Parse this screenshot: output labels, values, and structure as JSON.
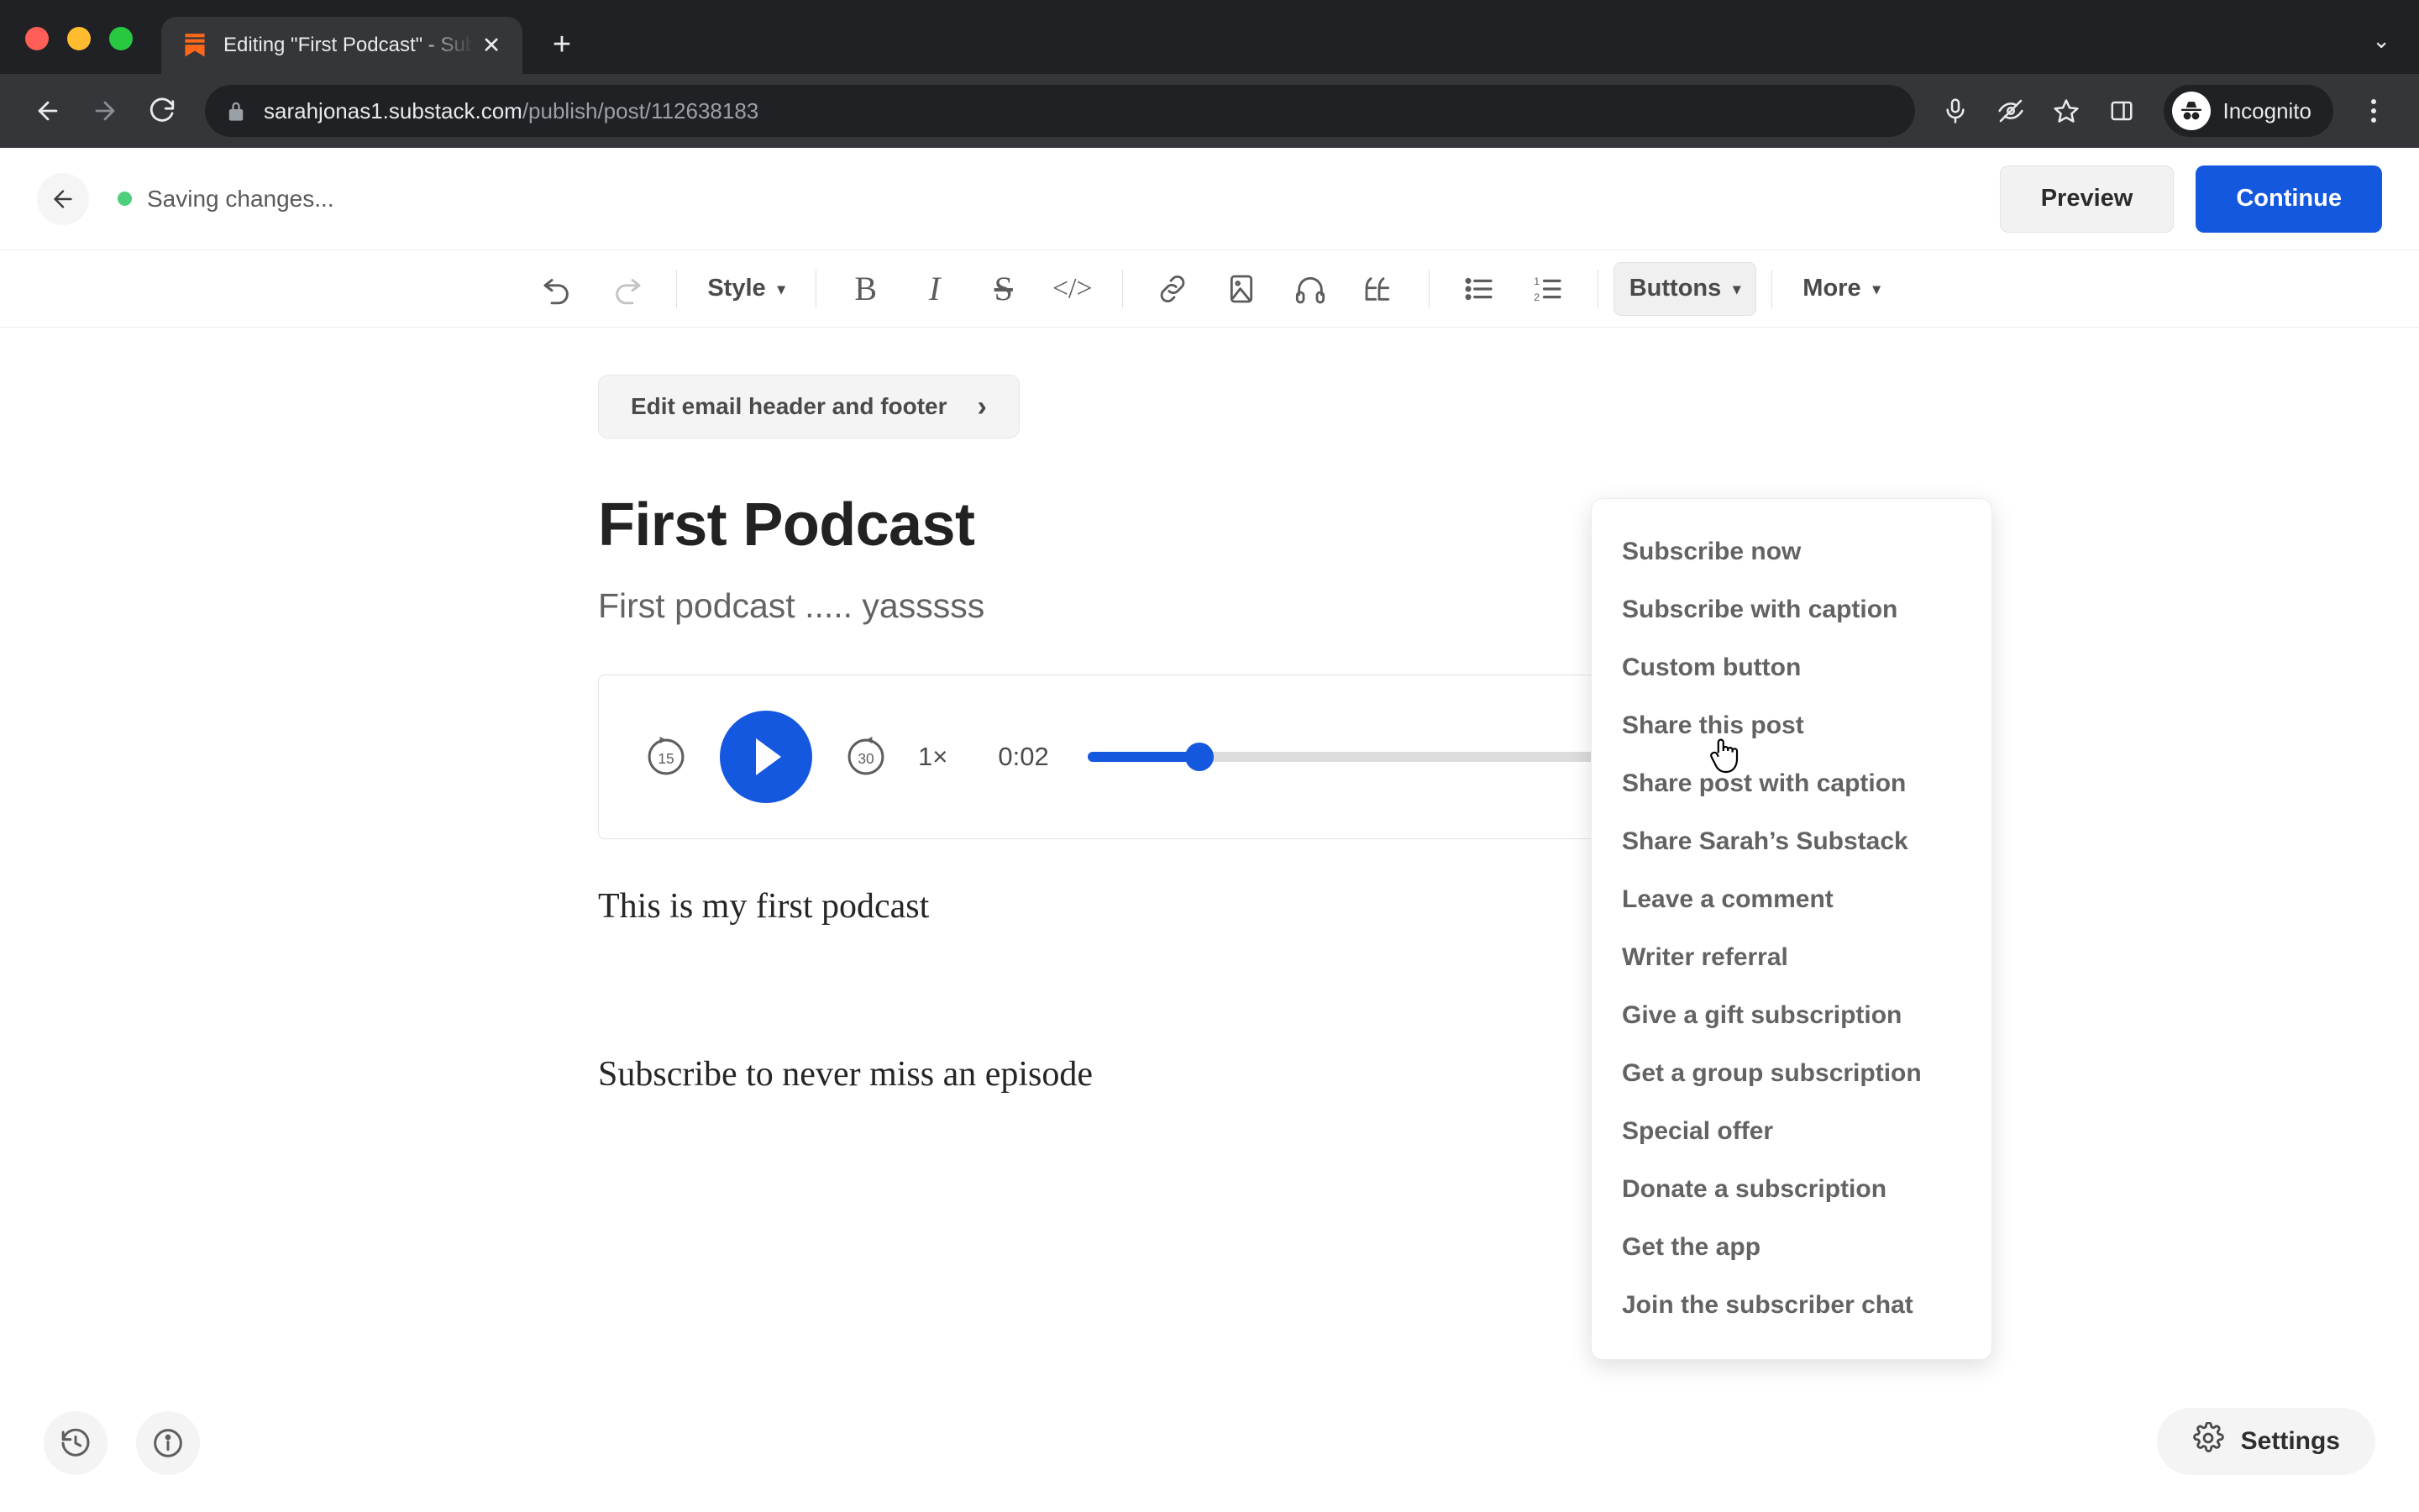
{
  "browser": {
    "tab": {
      "title": "Editing \"First Podcast\" - Substack",
      "favicon_name": "substack-favicon",
      "close_label": "✕"
    },
    "new_tab_label": "+",
    "tabstrip_chevron": "⌄",
    "nav": {
      "back_label": "←",
      "forward_label": "→",
      "reload_label": "⟳"
    },
    "url": {
      "domain": "sarahjonas1.substack.com",
      "path": "/publish/post/112638183"
    },
    "omnibox_icons": [
      "mic-icon",
      "incognito-blocked-icon",
      "bookmark-star-icon",
      "side-panel-icon"
    ],
    "profile": {
      "label": "Incognito"
    }
  },
  "appbar": {
    "back_label": "←",
    "status": "Saving changes...",
    "status_color": "#4ecf7b",
    "preview_label": "Preview",
    "continue_label": "Continue",
    "continue_color": "#1558e0"
  },
  "toolbar": {
    "undo_label": "↺",
    "redo_label": "↻",
    "style_label": "Style",
    "bold_label": "B",
    "italic_label": "I",
    "strike_label": "S",
    "code_label": "</>",
    "link_name": "link-icon",
    "image_name": "image-icon",
    "audio_name": "headphones-icon",
    "quote_name": "quote-icon",
    "bullet_list_name": "bullet-list-icon",
    "numbered_list_name": "numbered-list-icon",
    "buttons_label": "Buttons",
    "more_label": "More",
    "caret": "▾"
  },
  "dropdown": {
    "items": [
      {
        "label": "Subscribe now"
      },
      {
        "label": "Subscribe with caption"
      },
      {
        "label": "Custom button"
      },
      {
        "label": "Share this post"
      },
      {
        "label": "Share post with caption"
      },
      {
        "label": "Share Sarah’s Substack"
      },
      {
        "label": "Leave a comment"
      },
      {
        "label": "Writer referral"
      },
      {
        "label": "Give a gift subscription"
      },
      {
        "label": "Get a group subscription"
      },
      {
        "label": "Special offer"
      },
      {
        "label": "Donate a subscription"
      },
      {
        "label": "Get the app"
      },
      {
        "label": "Join the subscriber chat"
      }
    ]
  },
  "editor": {
    "email_header_footer_label": "Edit email header and footer",
    "email_header_footer_chevron": "›",
    "title": "First Podcast",
    "subtitle": "First podcast ..... yasssss",
    "paragraph_1": "This is my first podcast",
    "paragraph_2": "Subscribe to never miss an episode",
    "audio": {
      "skip_back_label": "15",
      "skip_forward_label": "30",
      "rate_label": "1×",
      "current_time": "0:02",
      "progress_percent": 17,
      "accent_color": "#1558e0"
    }
  },
  "footer": {
    "history_name": "history-clock-icon",
    "info_name": "info-circle-icon",
    "settings_label": "Settings",
    "settings_icon_name": "gear-icon"
  }
}
